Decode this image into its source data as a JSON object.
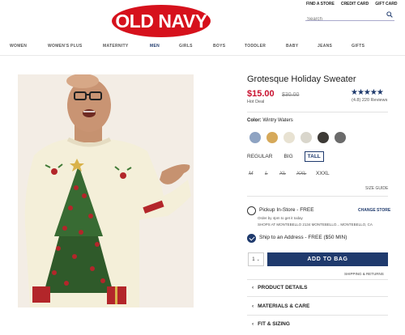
{
  "header": {
    "logo": "OLD NAVY",
    "util_links": [
      "FIND A STORE",
      "CREDIT CARD",
      "GIFT CARD"
    ],
    "search_placeholder": "Search"
  },
  "nav": {
    "items": [
      "WOMEN",
      "WOMEN'S PLUS",
      "MATERNITY",
      "MEN",
      "GIRLS",
      "BOYS",
      "TODDLER",
      "BABY",
      "JEANS",
      "GIFTS"
    ],
    "active": "MEN"
  },
  "product": {
    "title": "Grotesque Holiday Sweater",
    "price": "$15.00",
    "old_price": "$30.00",
    "hot_deal": "Hot Deal",
    "stars": "★★★★★",
    "rating": 4.8,
    "reviews": "(4.8) 220 Reviews",
    "color_label": "Color:",
    "color_value": "Wintry Waters",
    "swatches": [
      "#8ea3c2",
      "#d6a95a",
      "#e8e2d2",
      "#d9d6cc",
      "#3d3a36",
      "#6b6b6b"
    ],
    "size_types": [
      "REGULAR",
      "BIG",
      "TALL"
    ],
    "selected_size_type": "TALL",
    "sizes": [
      {
        "label": "M",
        "available": false
      },
      {
        "label": "L",
        "available": false
      },
      {
        "label": "XL",
        "available": false
      },
      {
        "label": "XXL",
        "available": false
      },
      {
        "label": "XXXL",
        "available": true
      }
    ],
    "size_guide": "SIZE GUIDE",
    "pickup_label": "Pickup In-Store - FREE",
    "change_store": "CHANGE STORE",
    "order_by": "Order by 4pm to get it today",
    "shops_at": "SHOPS AT MONTEBELLO 2134 MONTEBELLO...  MONTEBELLO, CA",
    "ship_label": "Ship to an Address - FREE ($50 MIN)",
    "qty": "1",
    "add_to_bag": "ADD TO BAG",
    "shipping_returns": "SHIPPING & RETURNS",
    "sections": [
      "PRODUCT DETAILS",
      "MATERIALS & CARE",
      "FIT & SIZING"
    ]
  }
}
